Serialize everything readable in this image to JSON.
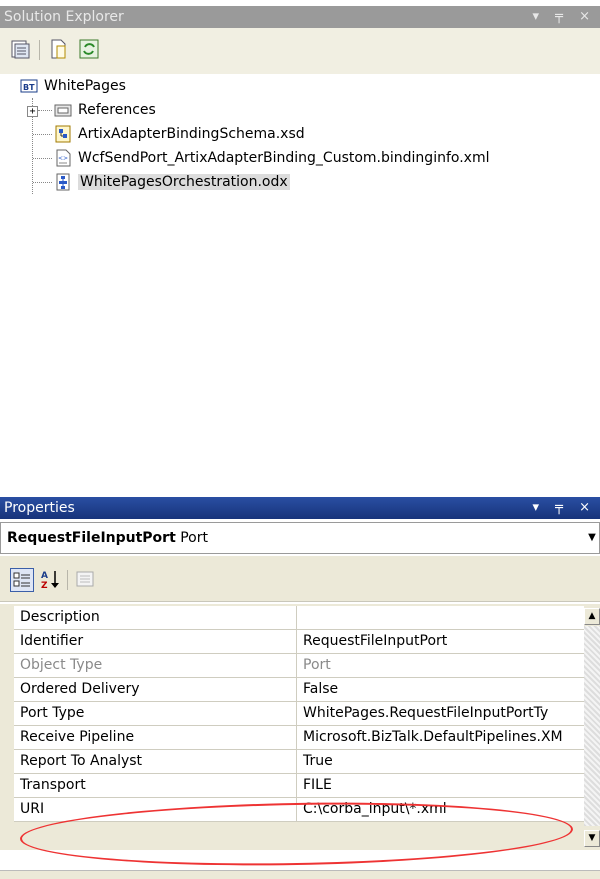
{
  "solution_explorer": {
    "title": "Solution Explorer",
    "title_controls": "▾ ╤ ×",
    "toolbar": [
      "properties-icon",
      "show-all-files-icon",
      "refresh-icon"
    ],
    "tree": {
      "project": "WhitePages",
      "items": [
        {
          "label": "References",
          "icon": "references-icon",
          "expandable": true
        },
        {
          "label": "ArtixAdapterBindingSchema.xsd",
          "icon": "schema-icon"
        },
        {
          "label": "WcfSendPort_ArtixAdapterBinding_Custom.bindinginfo.xml",
          "icon": "xml-file-icon"
        },
        {
          "label": "WhitePagesOrchestration.odx",
          "icon": "orchestration-icon",
          "selected": true
        }
      ]
    }
  },
  "properties": {
    "title": "Properties",
    "title_controls": "▾ ╤ ×",
    "object_name": "RequestFileInputPort",
    "object_type": "Port",
    "toolbar": [
      "categorized-icon",
      "alphabetical-icon",
      "property-pages-icon"
    ],
    "rows": [
      {
        "name": "Description",
        "value": ""
      },
      {
        "name": "Identifier",
        "value": "RequestFileInputPort"
      },
      {
        "name": "Object Type",
        "value": "Port",
        "disabled": true
      },
      {
        "name": "Ordered Delivery",
        "value": "False"
      },
      {
        "name": "Port Type",
        "value": "WhitePages.RequestFileInputPortTy"
      },
      {
        "name": "Receive Pipeline",
        "value": "Microsoft.BizTalk.DefaultPipelines.XM"
      },
      {
        "name": "Report To Analyst",
        "value": "True"
      },
      {
        "name": "Transport",
        "value": "FILE"
      },
      {
        "name": "URI",
        "value": "C:\\corba_input\\*.xml"
      }
    ],
    "highlight_color": "#e33333"
  }
}
